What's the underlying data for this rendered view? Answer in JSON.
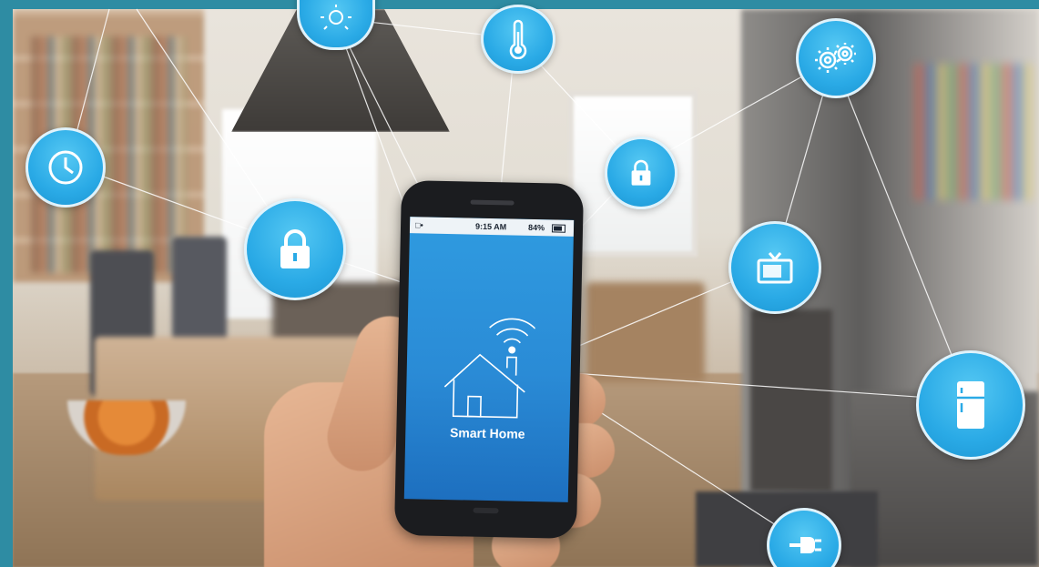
{
  "phone": {
    "status_signal": "□•",
    "status_time": "9:15 AM",
    "status_battery": "84%",
    "app_label": "Smart Home"
  },
  "nodes": [
    {
      "name": "light-icon"
    },
    {
      "name": "thermometer-icon"
    },
    {
      "name": "gears-icon"
    },
    {
      "name": "clock-icon"
    },
    {
      "name": "lock-icon"
    },
    {
      "name": "lock-icon"
    },
    {
      "name": "tv-icon"
    },
    {
      "name": "fridge-icon"
    },
    {
      "name": "plug-icon"
    },
    {
      "name": "wifi-icon"
    },
    {
      "name": "house-icon"
    }
  ],
  "colors": {
    "frame": "#2e8ca3",
    "node_blue": "#2aaae6",
    "screen_blue": "#2a8bd6"
  }
}
